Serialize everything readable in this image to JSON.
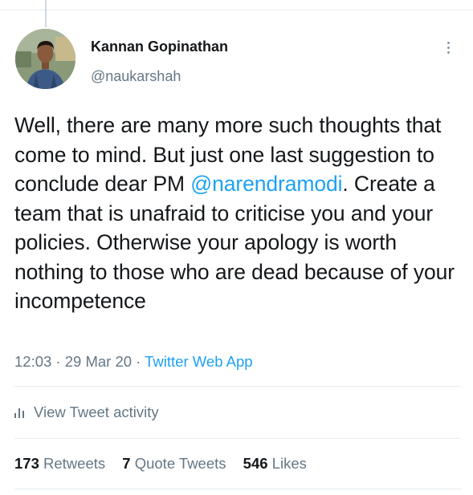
{
  "author": {
    "name": "Kannan Gopinathan",
    "handle": "@naukarshah"
  },
  "tweet": {
    "text_before": "Well, there are many more such thoughts that come to mind. But just one last suggestion to conclude dear PM ",
    "mention": "@narendramodi",
    "text_after": ". Create a team that is unafraid to criticise you and your policies. Otherwise your apology is worth nothing to those who are dead because of your incompetence"
  },
  "meta": {
    "time": "12:03",
    "separator": " · ",
    "date": "29 Mar 20",
    "app": "Twitter Web App"
  },
  "activity": {
    "label": "View Tweet activity",
    "icon": "bar-chart-icon"
  },
  "stats": {
    "retweets_count": "173",
    "retweets_label": "Retweets",
    "quotes_count": "7",
    "quotes_label": "Quote Tweets",
    "likes_count": "546",
    "likes_label": "Likes"
  },
  "colors": {
    "text": "#14171a",
    "secondary": "#657786",
    "link": "#1da1f2",
    "divider": "#e6ecf0"
  },
  "icons": {
    "more": "more-vertical-icon"
  }
}
